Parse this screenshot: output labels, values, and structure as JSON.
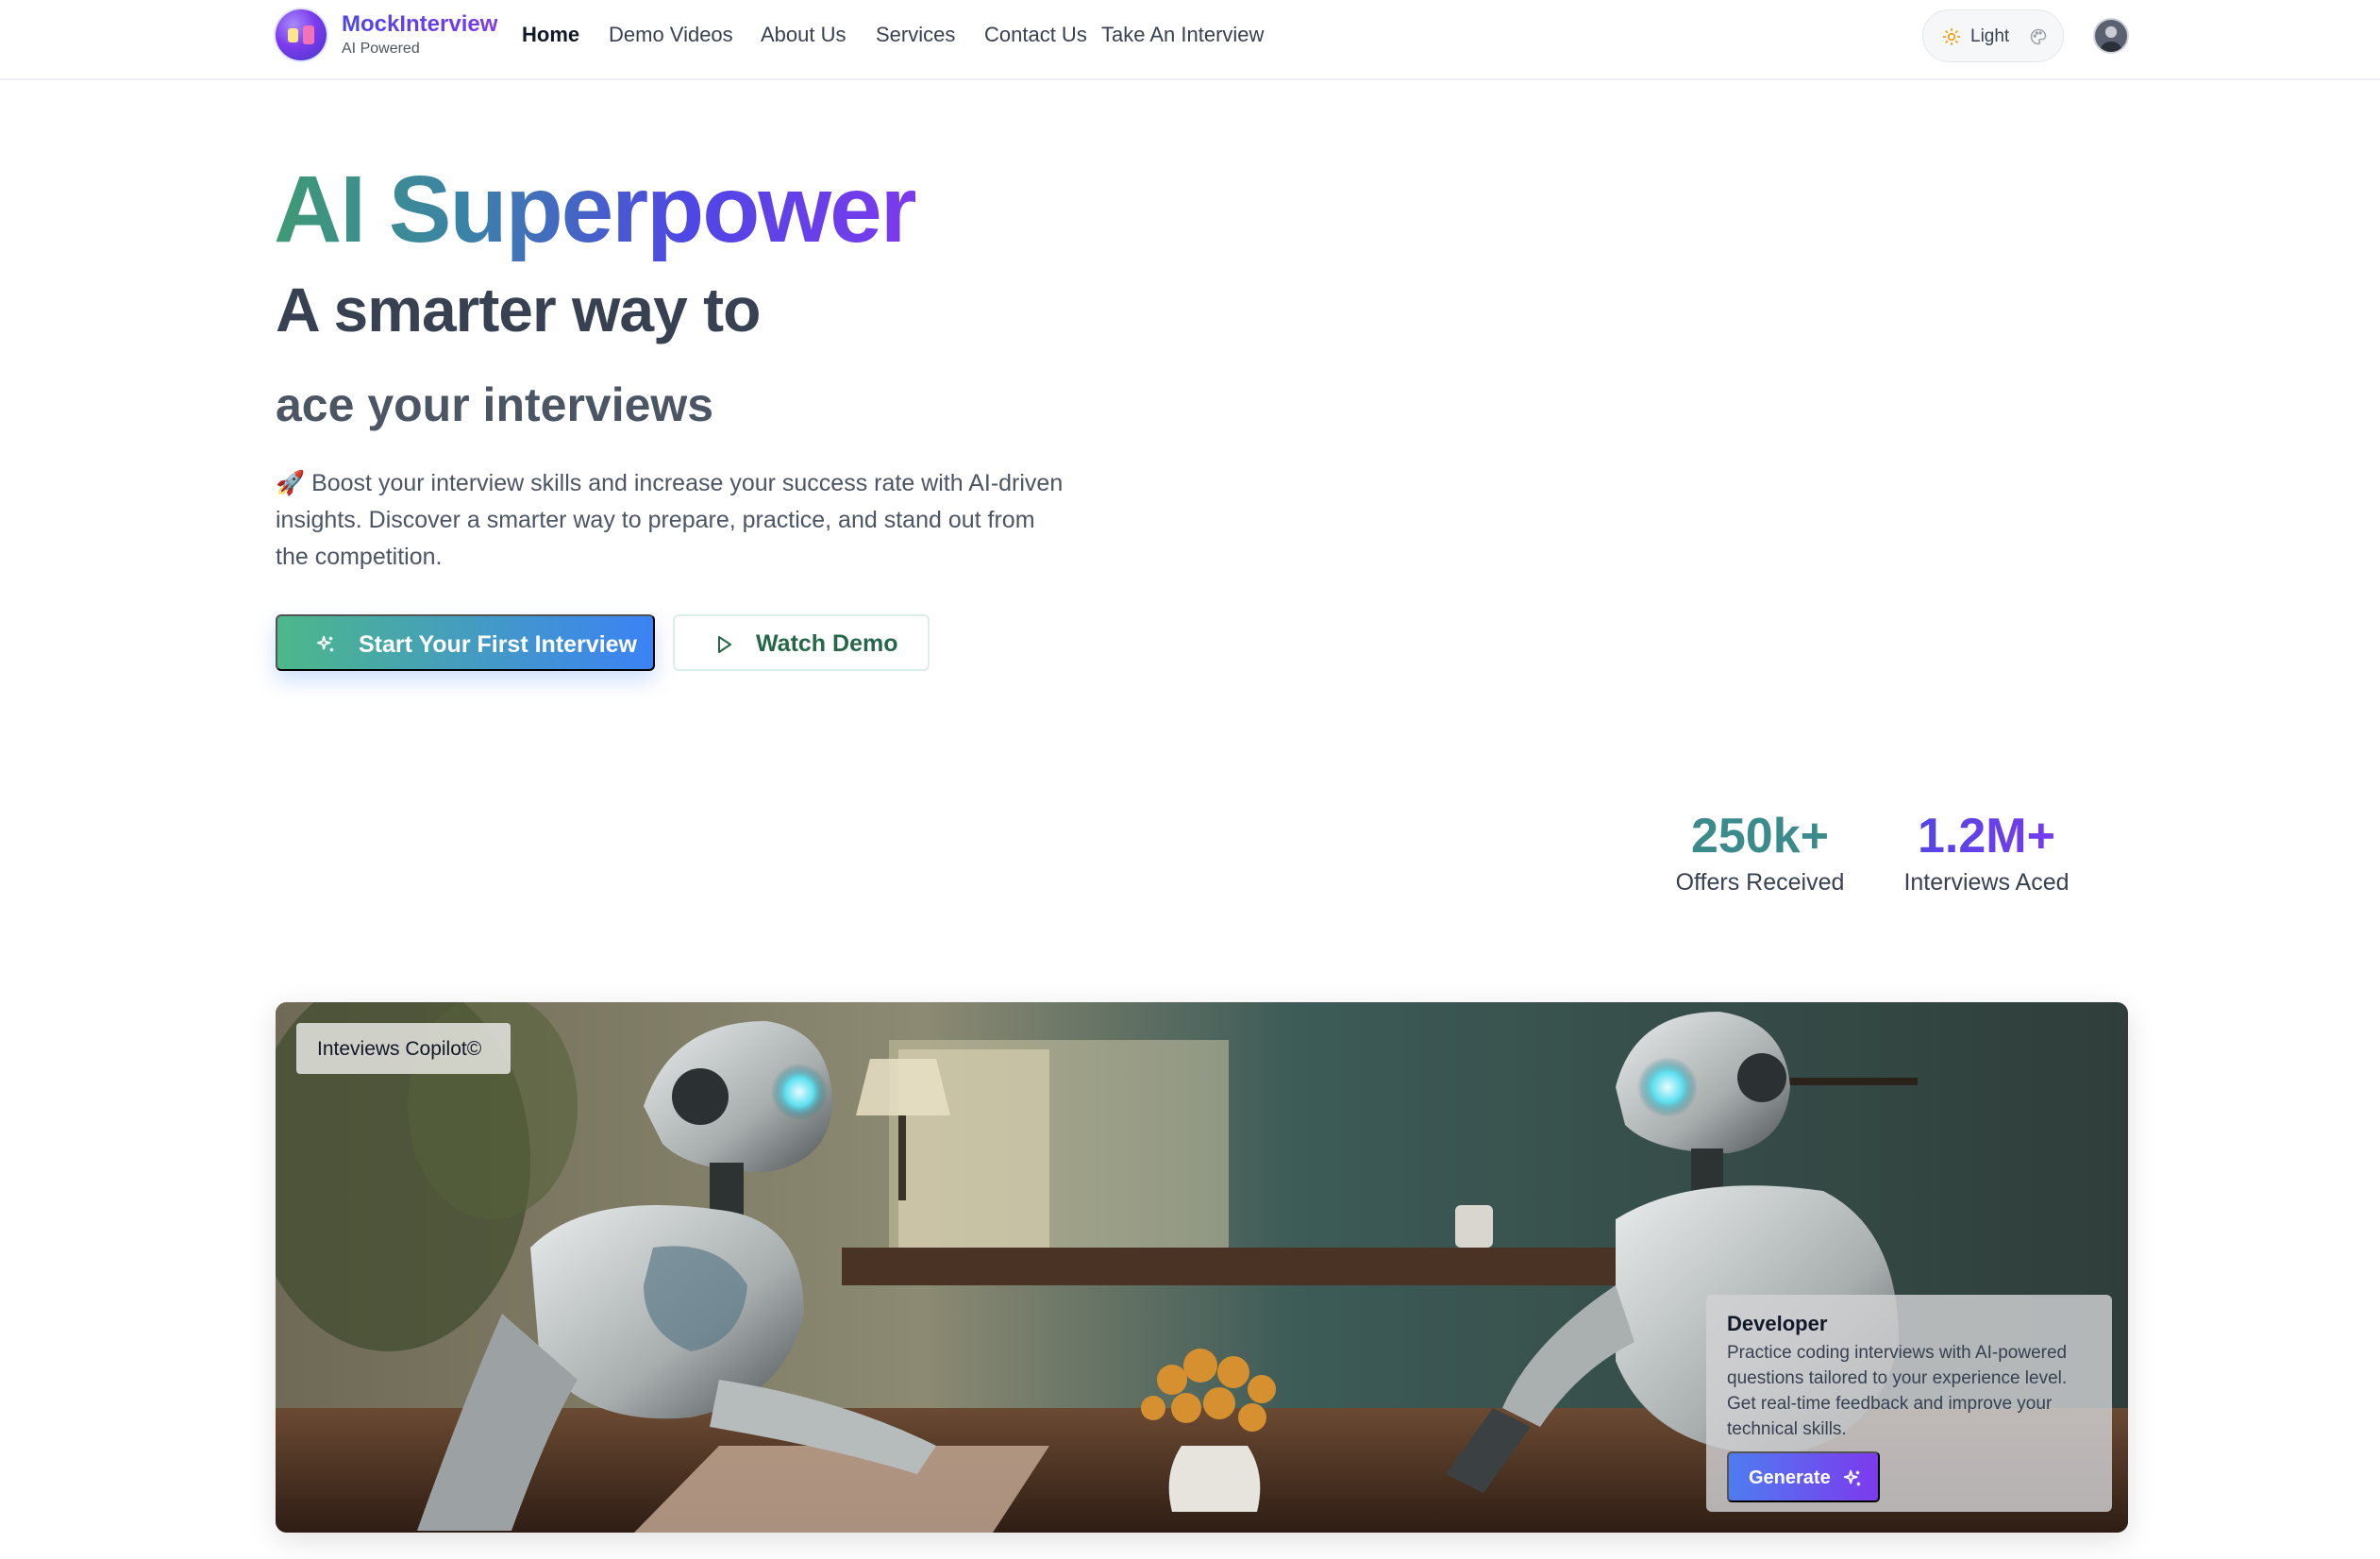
{
  "nav": {
    "brand_name": "MockInterview",
    "brand_sub": "AI Powered",
    "links": [
      {
        "label": "Home"
      },
      {
        "label": "Demo Videos"
      },
      {
        "label": "About Us"
      },
      {
        "label": "Services"
      },
      {
        "label": "Contact Us"
      },
      {
        "label": "Take An Interview"
      }
    ],
    "active_link": "Home",
    "theme_label": "Light"
  },
  "hero": {
    "title": "AI Superpower",
    "line1": "A smarter way to",
    "line2": "ace your interviews",
    "description": "🚀 Boost your interview skills and increase your success rate with AI-driven insights. Discover a smarter way to prepare, practice, and stand out from the competition.",
    "primary_button": "Start Your First Interview",
    "secondary_button": "Watch Demo"
  },
  "stats": [
    {
      "value": "250k+",
      "label": "Offers Received"
    },
    {
      "value": "1.2M+",
      "label": "Interviews Aced"
    }
  ],
  "showcase": {
    "badge": "Inteviews Copilot©",
    "card": {
      "title": "Developer",
      "text": "Practice coding interviews with AI-powered questions tailored to your experience level. Get real-time feedback and improve your technical skills.",
      "button": "Generate"
    }
  },
  "colors": {
    "brand_gradient_start": "#4f46e5",
    "brand_gradient_end": "#7c3aed",
    "hero_gradient_start": "#3f9a73",
    "primary_button_start": "#4db789",
    "primary_button_end": "#3b82f6",
    "secondary_button_text": "#276749"
  },
  "icons": [
    "sun-icon",
    "palette-icon",
    "sparkle-icon",
    "play-icon",
    "avatar"
  ]
}
